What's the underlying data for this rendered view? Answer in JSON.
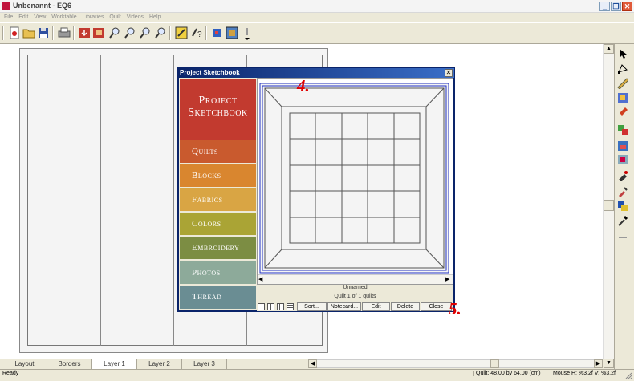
{
  "window": {
    "title": "Unbenannt - EQ6"
  },
  "menu": [
    "File",
    "Edit",
    "View",
    "Worktable",
    "Libraries",
    "Quilt",
    "Videos",
    "Help"
  ],
  "dialog": {
    "title": "Project Sketchbook",
    "banner_line1": "Project",
    "banner_line2": "Sketchbook",
    "categories": [
      {
        "label": "Quilts",
        "color": "#c95a2e"
      },
      {
        "label": "Blocks",
        "color": "#d9862f"
      },
      {
        "label": "Fabrics",
        "color": "#d9a544"
      },
      {
        "label": "Colors",
        "color": "#aaa435"
      },
      {
        "label": "Embroidery",
        "color": "#7c8d43"
      },
      {
        "label": "Photos",
        "color": "#8daa9a"
      },
      {
        "label": "Thread",
        "color": "#6a8d93"
      }
    ],
    "item_name": "Unnamed",
    "item_count": "Quilt 1 of 1 quilts",
    "buttons": [
      "Sort...",
      "Notecard...",
      "Edit",
      "Delete",
      "Close"
    ]
  },
  "annotations": {
    "a4": "4.",
    "a5": "5."
  },
  "tabs": [
    "Layout",
    "Borders",
    "Layer 1",
    "Layer 2",
    "Layer 3"
  ],
  "status": {
    "left": "Ready",
    "quilt": "Quilt:   48.00 by 64.00 (cm)",
    "mouse": "Mouse   H:  %3.2f    V:  %3.2f"
  },
  "colors": {
    "dialog_title": "#0a246a",
    "banner": "#c23a2f",
    "annotation": "#e00000"
  }
}
